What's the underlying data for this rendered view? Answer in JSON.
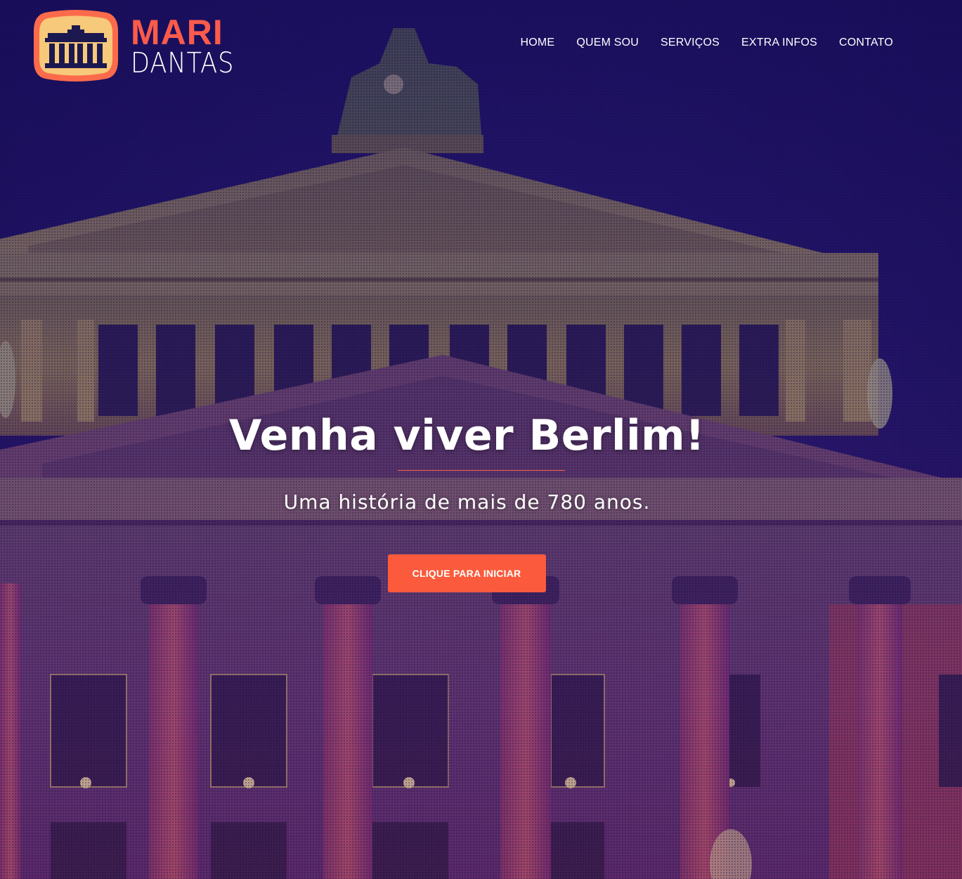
{
  "brand": {
    "line1": "MARI",
    "line2": "DANTAS",
    "colors": {
      "accent": "#fb5b4b",
      "badge_outer": "#fb6b4b",
      "badge_inner": "#f7c97a",
      "badge_icon": "#1c1850"
    },
    "icon": "brandenburg-gate-icon"
  },
  "nav": {
    "items": [
      {
        "label": "HOME"
      },
      {
        "label": "QUEM SOU"
      },
      {
        "label": "SERVIÇOS"
      },
      {
        "label": "EXTRA INFOS"
      },
      {
        "label": "CONTATO"
      }
    ]
  },
  "hero": {
    "title": "Venha viver Berlim!",
    "subtitle": "Uma história de mais de 780 anos.",
    "cta_label": "CLIQUE PARA INICIAR",
    "colors": {
      "cta": "#fb5b3c",
      "overlay": "#1a1060"
    }
  }
}
